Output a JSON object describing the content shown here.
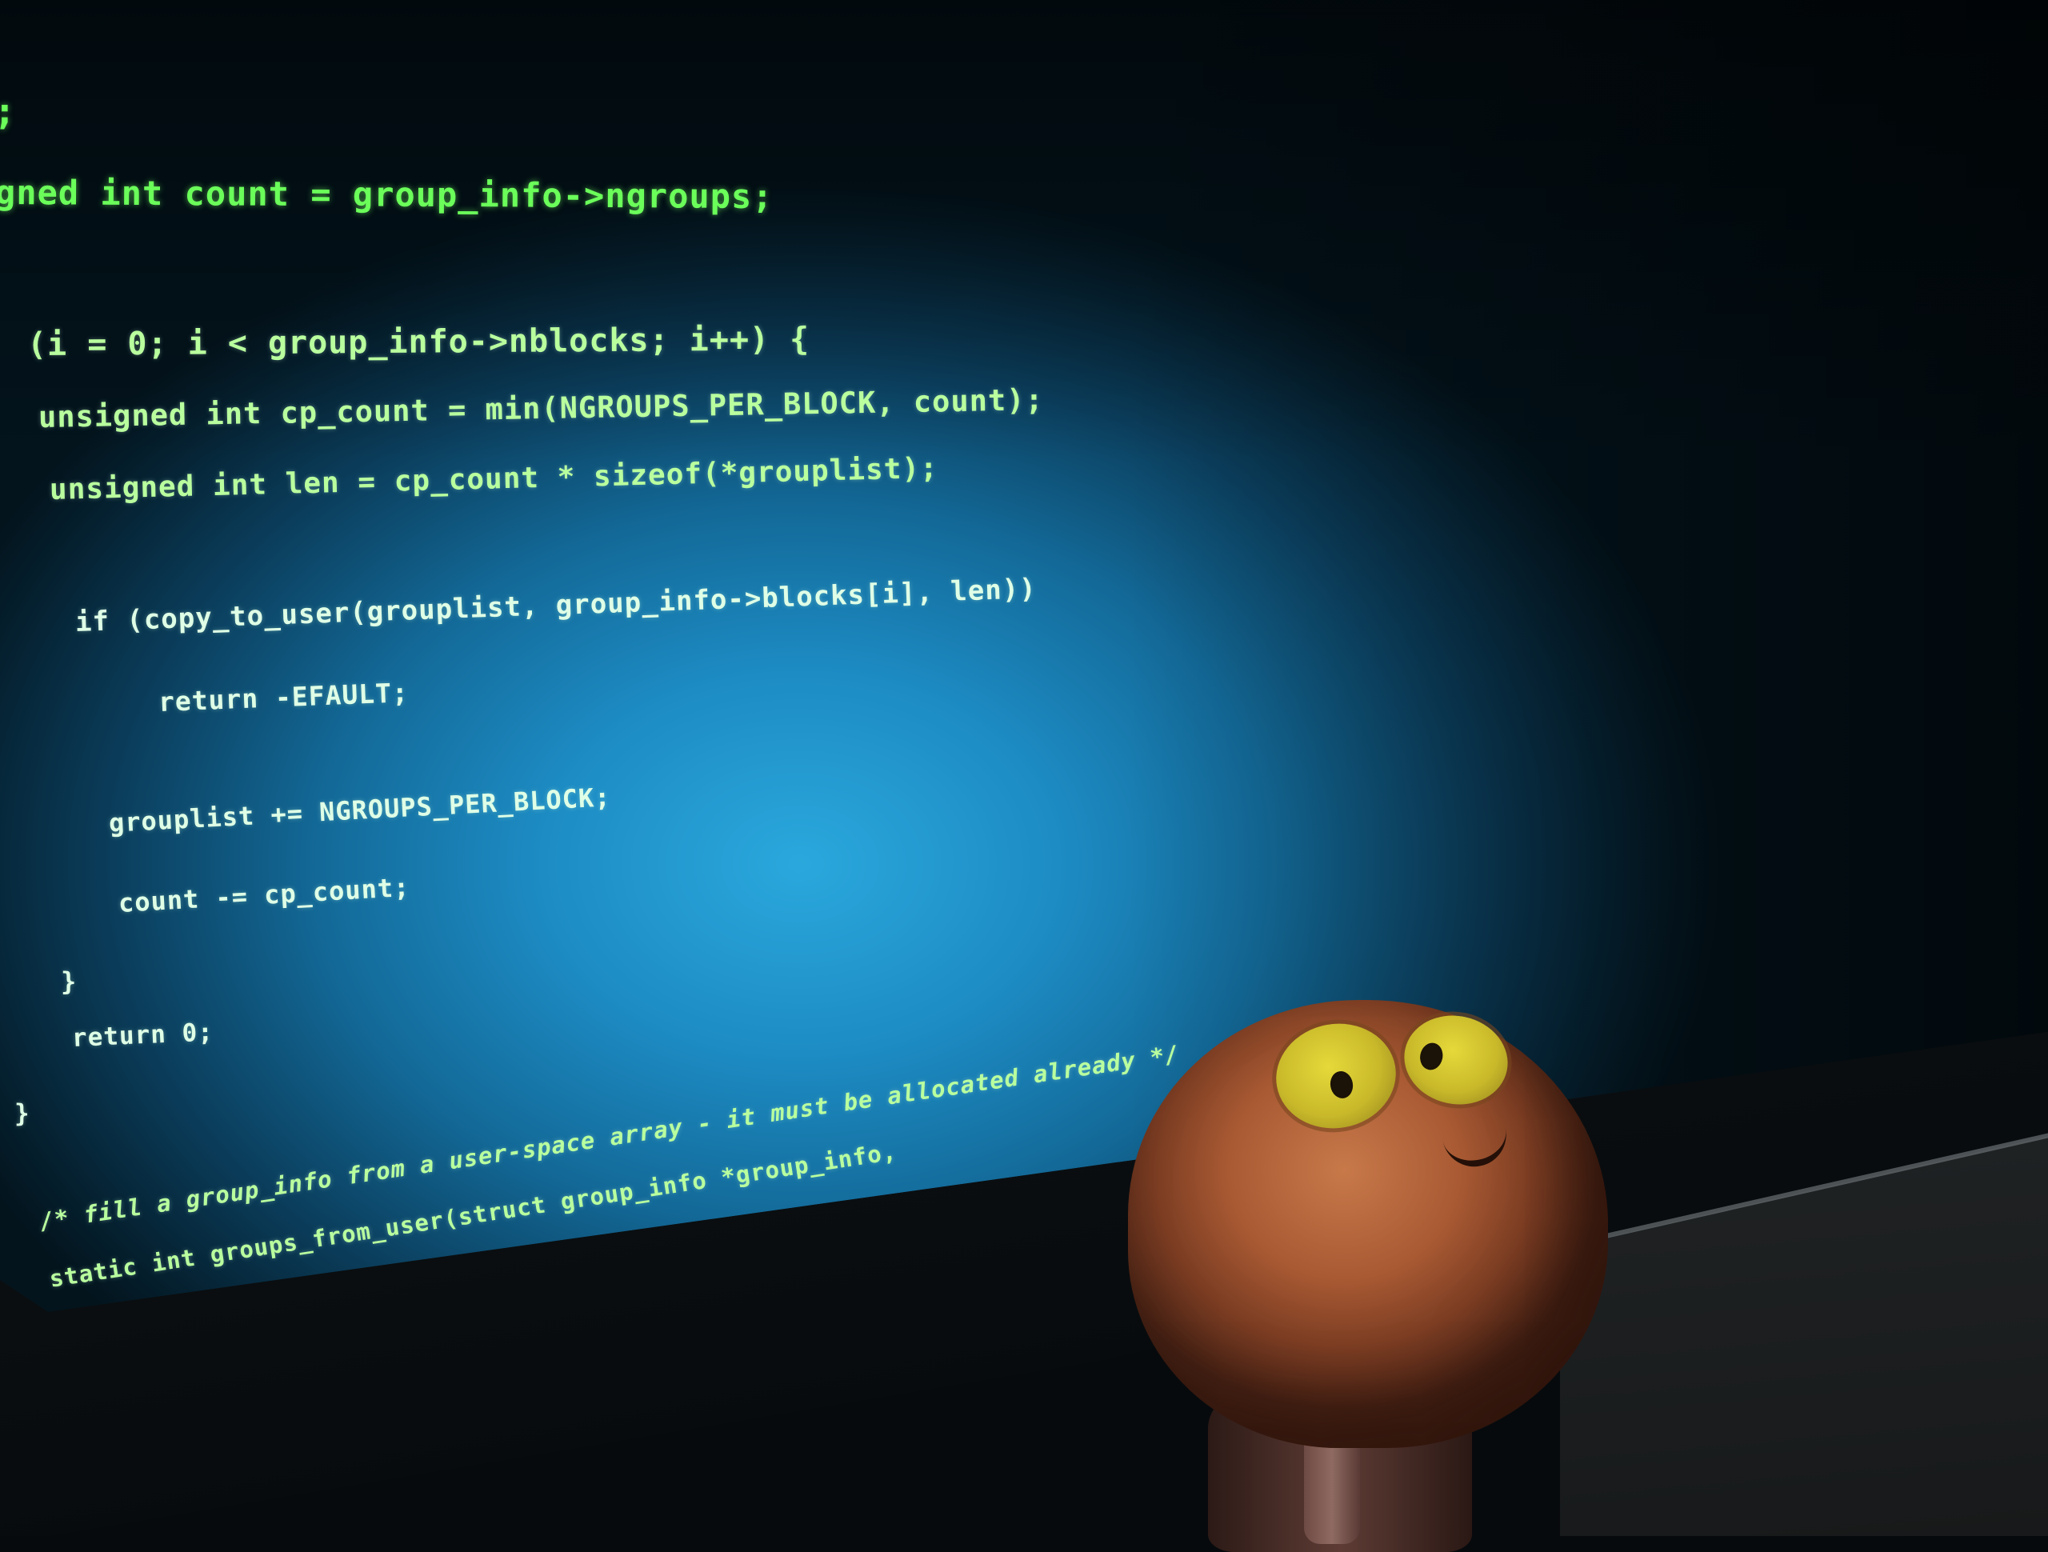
{
  "code_lines": [
    ";",
    "gned int count = group_info->ngroups;",
    "(i = 0; i < group_info->nblocks; i++) {",
    "unsigned int cp_count = min(NGROUPS_PER_BLOCK, count);",
    "unsigned int len = cp_count * sizeof(*grouplist);",
    "if (copy_to_user(grouplist, group_info->blocks[i], len))",
    "return -EFAULT;",
    "grouplist += NGROUPS_PER_BLOCK;",
    "count -= cp_count;",
    "}",
    "return 0;",
    "}",
    "/* fill a group_info from a user-space array - it must be allocated already */",
    "static int groups_from_user(struct group_info *group_info,"
  ],
  "colors": {
    "screen_center": "#2aa8dd",
    "code_green": "#6bff5a",
    "code_pale": "#dfffe6",
    "plush_orange": "#a95a33",
    "plush_eye": "#e5d93a"
  }
}
